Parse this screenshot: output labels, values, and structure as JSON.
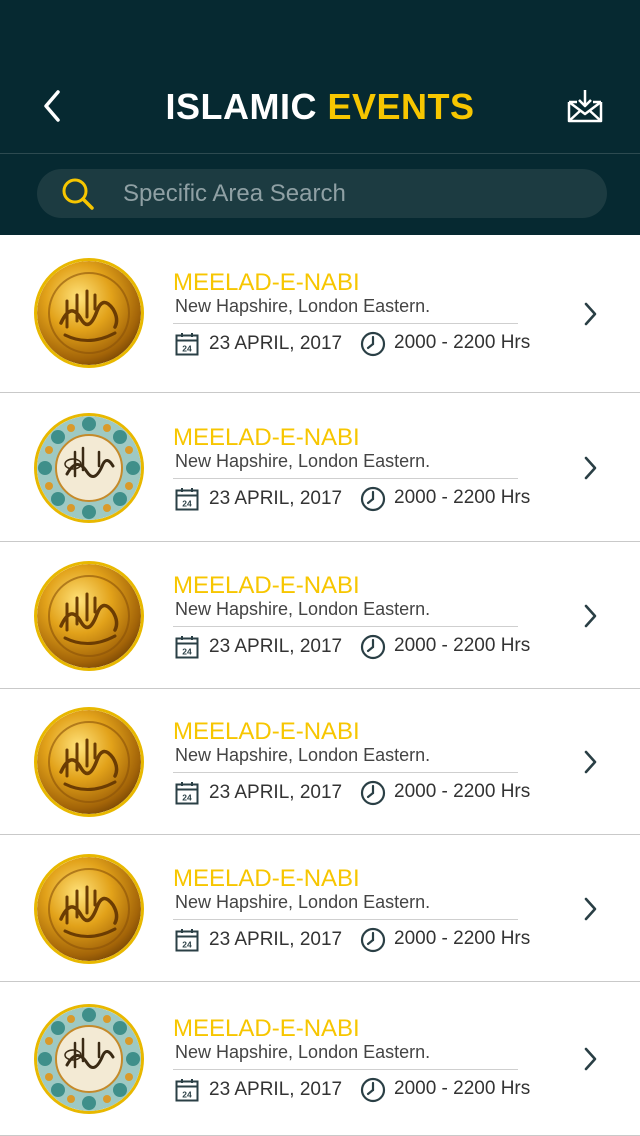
{
  "header": {
    "back_icon": "chevron-left-icon",
    "title_part1": "ISLAMIC ",
    "title_part2": "EVENTS",
    "inbox_icon": "inbox-download-icon"
  },
  "colors": {
    "header_bg": "#062931",
    "search_bg": "#1c3b41",
    "accent": "#f7c600",
    "text_dark": "#333333"
  },
  "search": {
    "placeholder": "Specific Area Search",
    "icon": "search-icon"
  },
  "events": [
    {
      "title": "MEELAD-E-NABI",
      "location": "New Hapshire, London Eastern.",
      "date": "23 APRIL, 2017",
      "time": "2000 - 2200 Hrs",
      "image": "gold-calligraphy-medallion",
      "calendar_day": "24"
    },
    {
      "title": "MEELAD-E-NABI",
      "location": "New Hapshire, London Eastern.",
      "date": "23 APRIL, 2017",
      "time": "2000 - 2200 Hrs",
      "image": "floral-calligraphy-medallion",
      "calendar_day": "24"
    },
    {
      "title": "MEELAD-E-NABI",
      "location": "New Hapshire, London Eastern.",
      "date": "23 APRIL, 2017",
      "time": "2000 - 2200 Hrs",
      "image": "gold-calligraphy-medallion",
      "calendar_day": "24"
    },
    {
      "title": "MEELAD-E-NABI",
      "location": "New Hapshire, London Eastern.",
      "date": "23 APRIL, 2017",
      "time": "2000 - 2200 Hrs",
      "image": "gold-calligraphy-medallion",
      "calendar_day": "24"
    },
    {
      "title": "MEELAD-E-NABI",
      "location": "New Hapshire, London Eastern.",
      "date": "23 APRIL, 2017",
      "time": "2000 - 2200 Hrs",
      "image": "gold-calligraphy-medallion",
      "calendar_day": "24"
    },
    {
      "title": "MEELAD-E-NABI",
      "location": "New Hapshire, London Eastern.",
      "date": "23 APRIL, 2017",
      "time": "2000 - 2200 Hrs",
      "image": "floral-calligraphy-medallion",
      "calendar_day": "24"
    }
  ]
}
